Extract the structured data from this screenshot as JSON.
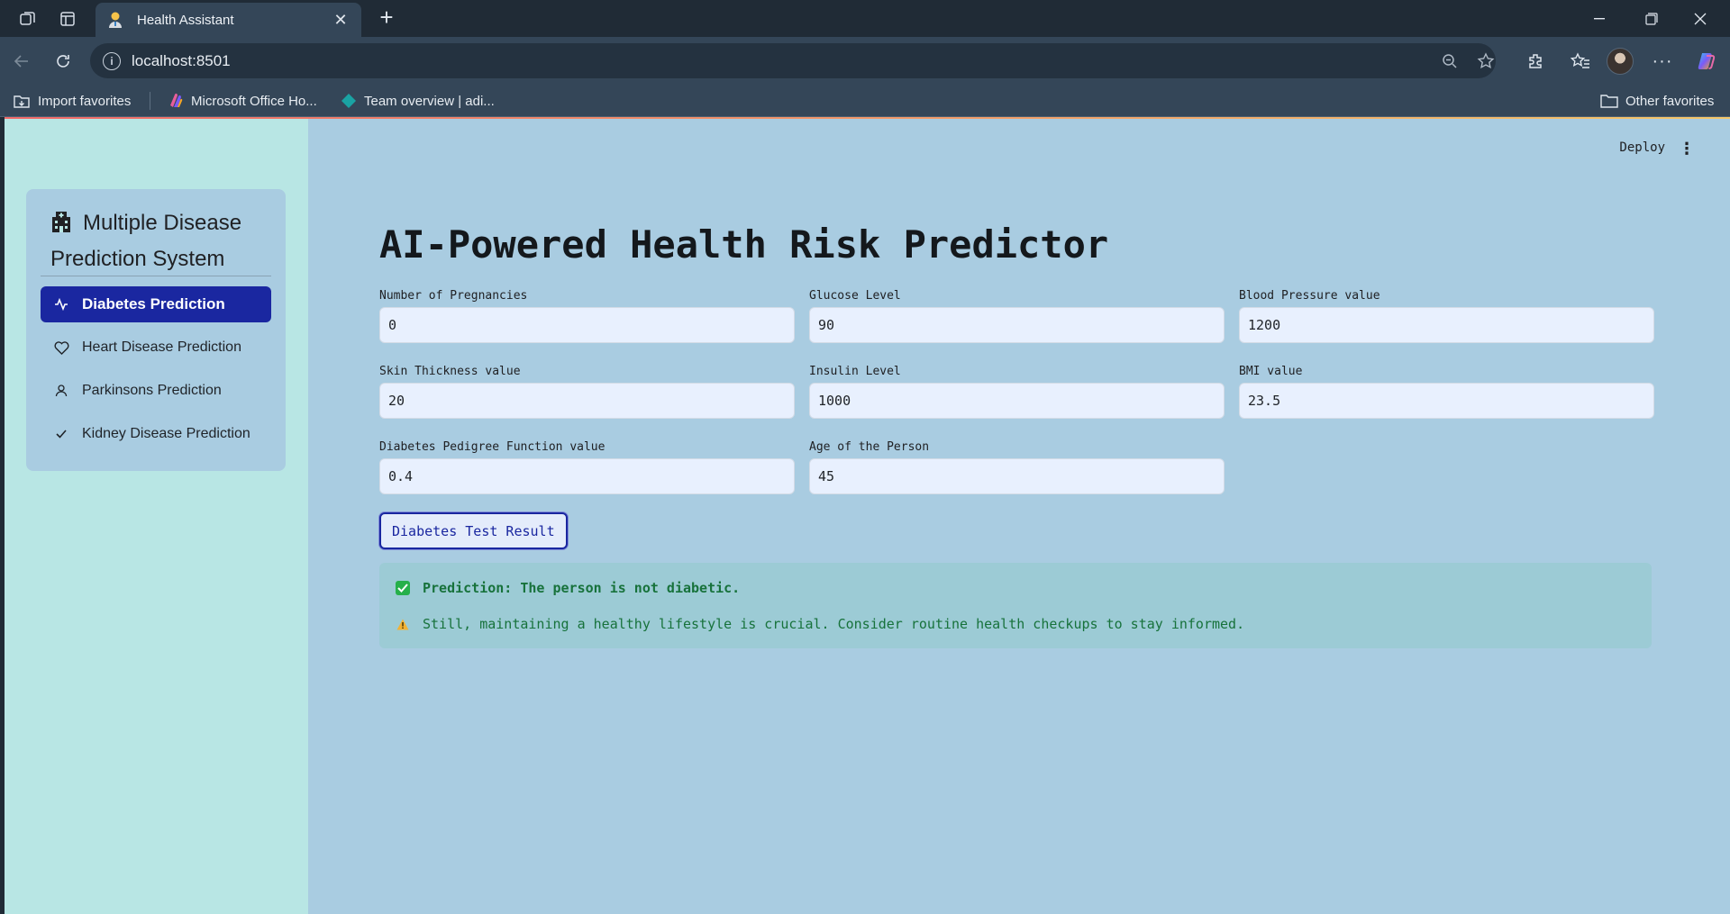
{
  "browser": {
    "tab_title": "Health Assistant",
    "url": "localhost:8501",
    "bookmarks": [
      {
        "label": "Import favorites",
        "icon": "import-favorites-icon"
      },
      {
        "label": "Microsoft Office Ho...",
        "icon": "office-icon"
      },
      {
        "label": "Team overview | adi...",
        "icon": "team-icon"
      }
    ],
    "other_favorites": "Other favorites"
  },
  "app": {
    "header": {
      "deploy_label": "Deploy"
    },
    "sidebar": {
      "title": "Multiple Disease Prediction System",
      "title_icon": "hospital-icon",
      "items": [
        {
          "label": "Diabetes Prediction",
          "icon": "activity-icon",
          "active": true
        },
        {
          "label": "Heart Disease Prediction",
          "icon": "heart-icon",
          "active": false
        },
        {
          "label": "Parkinsons Prediction",
          "icon": "person-icon",
          "active": false
        },
        {
          "label": "Kidney Disease Prediction",
          "icon": "check-icon",
          "active": false
        }
      ]
    },
    "main": {
      "title": "AI-Powered Health Risk Predictor",
      "fields": [
        {
          "label": "Number of Pregnancies",
          "value": "0"
        },
        {
          "label": "Glucose Level",
          "value": "90"
        },
        {
          "label": "Blood Pressure value",
          "value": "1200"
        },
        {
          "label": "Skin Thickness value",
          "value": "20"
        },
        {
          "label": "Insulin Level",
          "value": "1000"
        },
        {
          "label": "BMI value",
          "value": "23.5"
        },
        {
          "label": "Diabetes Pedigree Function value",
          "value": "0.4"
        },
        {
          "label": "Age of the Person",
          "value": "45"
        }
      ],
      "button_label": "Diabetes Test Result",
      "result": {
        "prediction": "Prediction: The person is not diabetic.",
        "advice": "Still, maintaining a healthy lifestyle is crucial. Consider routine health checkups to stay informed."
      }
    },
    "colors": {
      "accent": "#1a27a0",
      "sidebar_bg": "#b8e6e4",
      "main_bg": "#a9cce1",
      "success_text": "#17723b"
    }
  }
}
